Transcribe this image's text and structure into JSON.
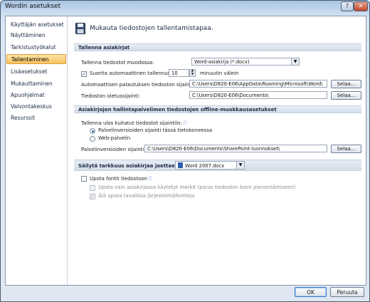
{
  "window": {
    "title": "Wordin asetukset",
    "help_label": "?",
    "close_label": "✕"
  },
  "sidebar": {
    "items": [
      {
        "label": "Käyttäjän asetukset"
      },
      {
        "label": "Näyttäminen"
      },
      {
        "label": "Tarkistustyökalut"
      },
      {
        "label": "Tallentaminen",
        "active": true
      },
      {
        "label": "Lisäasetukset"
      },
      {
        "label": "Mukauttaminen"
      },
      {
        "label": "Apuohjelmat"
      },
      {
        "label": "Valvontakeskus"
      },
      {
        "label": "Resurssit"
      }
    ]
  },
  "banner": {
    "text": "Mukauta tiedostojen tallentamistapaa."
  },
  "section_save": {
    "header": "Tallenna asiakirjat",
    "format_label": "Tallenna tiedostot muodossa:",
    "format_value": "Word-asiakirja (*.docx)",
    "autorecover_check": "✓",
    "autorecover_label": "Suorita automaattinen tallennus",
    "autorecover_minutes": "10",
    "autorecover_unit": "minuutin välein",
    "autorecover_path_label": "Automaattisen palautuksen tiedoston sijainti:",
    "autorecover_path": "C:\\Users\\D820-E06\\AppData\\Roaming\\Microsoft\\Word\\",
    "default_path_label": "Tiedoston oletussijainti:",
    "default_path": "C:\\Users\\D820-E06\\Documents\\",
    "browse_label": "Selaa..."
  },
  "section_offline": {
    "header": "Asiakirjojen hallintapalvelimen tiedostojen offline-muokkausasetukset",
    "checkout_label": "Tallenna ulos kuitatut tiedostot sijaintiin:",
    "radio_local": "Palvelinversioiden sijainti tässä tietokoneessa",
    "radio_web": "Web-palvelin",
    "drafts_label": "Palvelinversioiden sijainti:",
    "drafts_path": "C:\\Users\\D820-E06\\Documents\\SharePoint-luonnokset\\",
    "browse_label": "Selaa..."
  },
  "section_fidelity": {
    "header_label": "Säilytä tarkkuus asiakirjaa jaettaessa:",
    "doc_value": "Word 2007.docx",
    "embed_fonts": "Upota fontit tiedostoon",
    "embed_only_used": "Upota vain asiakirjassa käytetyt merkit (paras tiedoston koon pienentämiseen)",
    "no_system_fonts": "Älä upota tavallisia järjestelmäfontteja",
    "no_system_fonts_check": "✓"
  },
  "footer": {
    "ok": "OK",
    "cancel": "Peruuta"
  },
  "icons": {
    "info": "ⓘ",
    "dropdown": "▼",
    "spin_up": "▲",
    "spin_down": "▼",
    "grip": "⋰"
  }
}
